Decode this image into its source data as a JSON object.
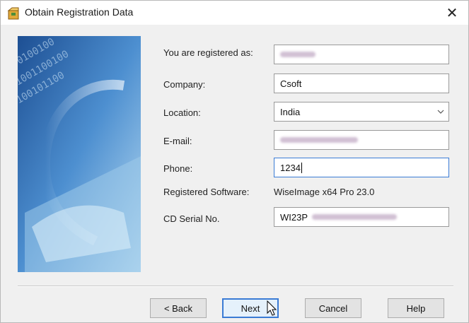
{
  "window": {
    "title": "Obtain Registration Data",
    "close_glyph": "✕"
  },
  "form": {
    "registered_as": {
      "label": "You are registered as:",
      "value": ""
    },
    "company": {
      "label": "Company:",
      "value": "Csoft"
    },
    "location": {
      "label": "Location:",
      "value": "India"
    },
    "email": {
      "label": "E-mail:",
      "value": ""
    },
    "phone": {
      "label": "Phone:",
      "value": "1234"
    },
    "software": {
      "label": "Registered Software:",
      "value": "WiseImage x64 Pro  23.0"
    },
    "serial": {
      "label": "CD Serial No.",
      "value": "WI23P"
    }
  },
  "buttons": {
    "back": "< Back",
    "next": "Next",
    "cancel": "Cancel",
    "help": "Help"
  },
  "colors": {
    "focus": "#3a7bd5",
    "dialog_bg": "#f0f0f0"
  },
  "icons": {
    "app": "setup-box-icon",
    "close": "close-icon",
    "dropdown": "chevron-down-icon",
    "cursor": "mouse-pointer-icon"
  }
}
